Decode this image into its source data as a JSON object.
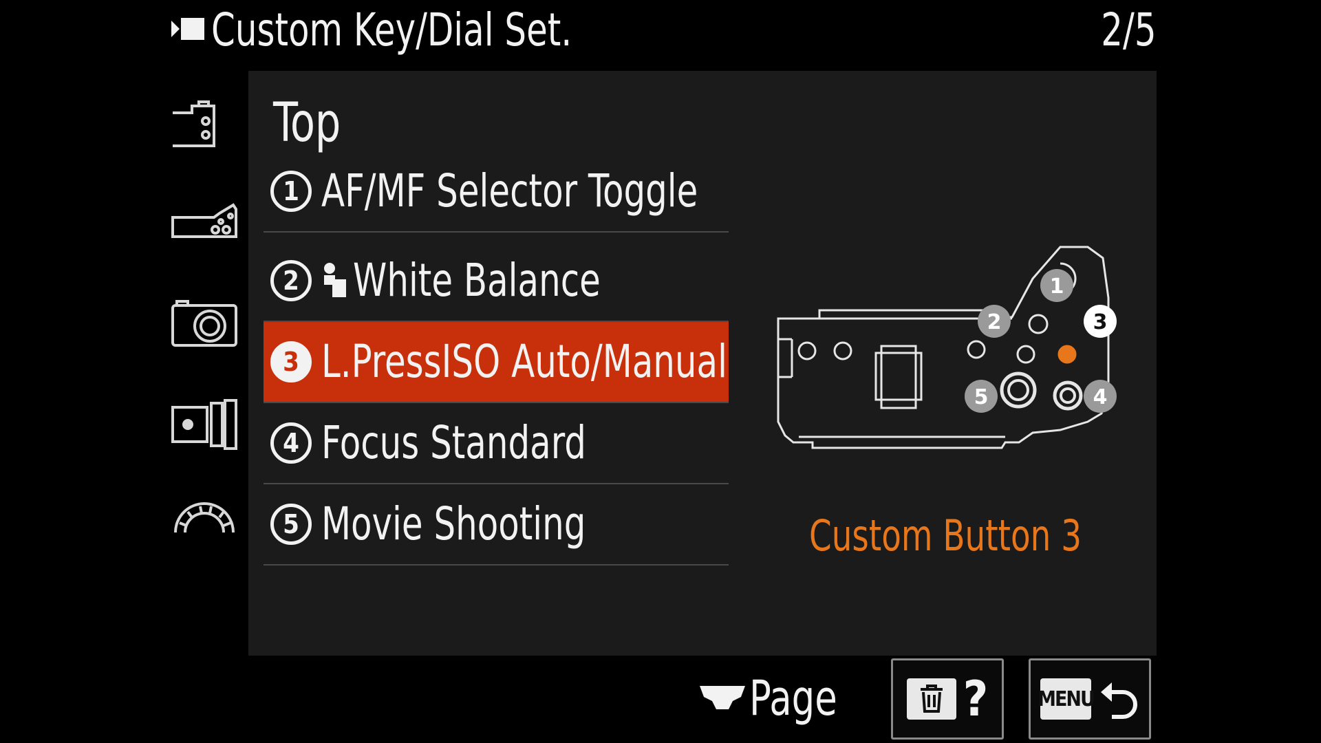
{
  "header": {
    "title": "Custom Key/Dial Set.",
    "page_indicator": "2/5",
    "mode_icon": "movie-mode-icon"
  },
  "sidebar": {
    "items": [
      {
        "icon": "camera-back-buttons-icon"
      },
      {
        "icon": "camera-top-buttons-icon"
      },
      {
        "icon": "camera-front-icon"
      },
      {
        "icon": "lens-icon"
      },
      {
        "icon": "dial-icon"
      }
    ]
  },
  "panel": {
    "section_title": "Top",
    "items": [
      {
        "num": "1",
        "label": "AF/MF Selector Toggle",
        "selected": false
      },
      {
        "num": "2",
        "label": "White Balance",
        "selected": false,
        "icon": "white-balance-icon"
      },
      {
        "num": "3",
        "label": "L.PressISO Auto/Manual",
        "selected": true
      },
      {
        "num": "4",
        "label": "Focus Standard",
        "selected": false
      },
      {
        "num": "5",
        "label": "Movie Shooting",
        "selected": false
      }
    ],
    "diagram": {
      "callouts": [
        "1",
        "2",
        "3",
        "4",
        "5"
      ],
      "highlighted": "3"
    },
    "button_caption": "Custom Button 3"
  },
  "footer": {
    "page_label": "Page",
    "help_label": "?",
    "menu_label": "MENU"
  },
  "colors": {
    "selected_bg": "#c7300a",
    "caption": "#e8761a",
    "panel_bg": "#1b1b1b"
  }
}
